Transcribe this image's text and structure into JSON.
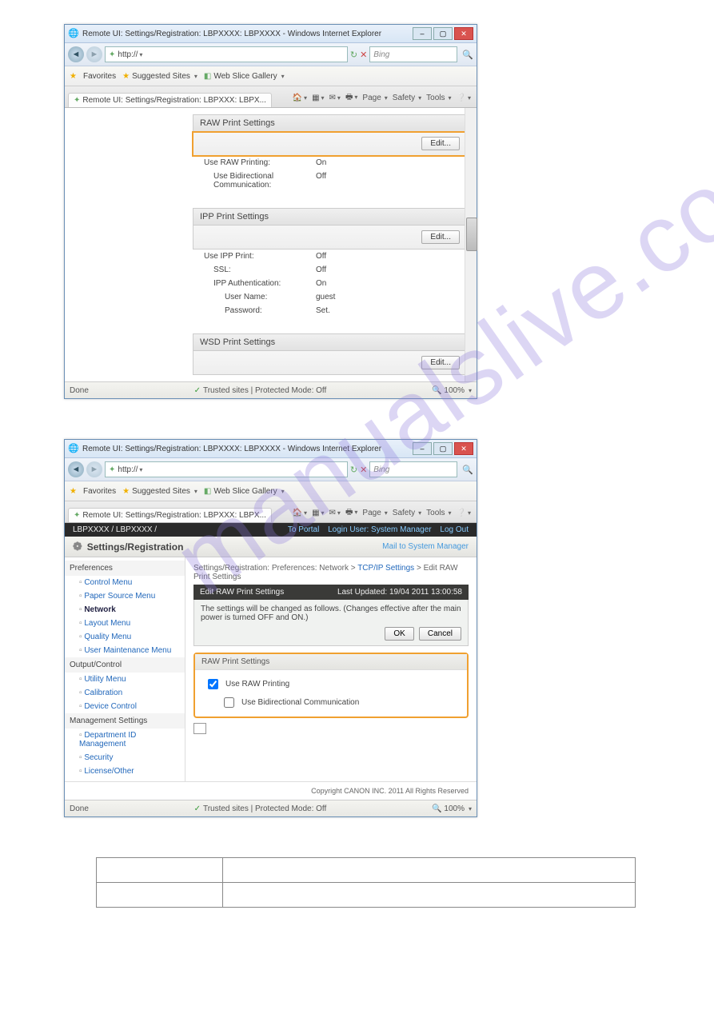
{
  "watermark": "manualslive.com",
  "window1": {
    "title": "Remote UI: Settings/Registration: LBPXXXX: LBPXXXX - Windows Internet Explorer",
    "url_prefix": "http://",
    "search_placeholder": "Bing",
    "favbar": {
      "favorites": "Favorites",
      "suggested": "Suggested Sites",
      "webslice": "Web Slice Gallery"
    },
    "tab_label": "Remote UI: Settings/Registration: LBPXXX: LBPX...",
    "toolbar": {
      "page": "Page",
      "safety": "Safety",
      "tools": "Tools"
    },
    "raw": {
      "section": "RAW Print Settings",
      "edit": "Edit...",
      "use_raw_label": "Use RAW Printing:",
      "use_raw_val": "On",
      "bidir_label": "Use Bidirectional Communication:",
      "bidir_val": "Off"
    },
    "ipp": {
      "section": "IPP Print Settings",
      "edit": "Edit...",
      "use_ipp_label": "Use IPP Print:",
      "use_ipp_val": "Off",
      "ssl_label": "SSL:",
      "ssl_val": "Off",
      "auth_label": "IPP Authentication:",
      "auth_val": "On",
      "user_label": "User Name:",
      "user_val": "guest",
      "pass_label": "Password:",
      "pass_val": "Set."
    },
    "wsd": {
      "section": "WSD Print Settings",
      "edit": "Edit..."
    },
    "status": {
      "done": "Done",
      "trusted": "Trusted sites | Protected Mode: Off",
      "zoom": "100%"
    }
  },
  "window2": {
    "title": "Remote UI: Settings/Registration: LBPXXXX: LBPXXXX - Windows Internet Explorer",
    "url_prefix": "http://",
    "search_placeholder": "Bing",
    "favbar": {
      "favorites": "Favorites",
      "suggested": "Suggested Sites",
      "webslice": "Web Slice Gallery"
    },
    "tab_label": "Remote UI: Settings/Registration: LBPXXX: LBPX...",
    "toolbar": {
      "page": "Page",
      "safety": "Safety",
      "tools": "Tools"
    },
    "blackbar": {
      "device": "LBPXXXX / LBPXXXX /",
      "portal": "To Portal",
      "login": "Login User: System Manager",
      "logout": "Log Out"
    },
    "reg": {
      "title": "Settings/Registration",
      "mailto": "Mail to System Manager"
    },
    "sidebar": {
      "cat1": "Preferences",
      "items1": [
        "Control Menu",
        "Paper Source Menu",
        "Network",
        "Layout Menu",
        "Quality Menu",
        "User Maintenance Menu"
      ],
      "cat2": "Output/Control",
      "items2": [
        "Utility Menu",
        "Calibration",
        "Device Control"
      ],
      "cat3": "Management Settings",
      "items3": [
        "Department ID Management",
        "Security",
        "License/Other"
      ]
    },
    "main": {
      "breadcrumb_prefix": "Settings/Registration: Preferences: Network > ",
      "breadcrumb_link": "TCP/IP Settings",
      "breadcrumb_tail": " > Edit RAW Print Settings",
      "panel_title": "Edit RAW Print Settings",
      "panel_updated": "Last Updated: 19/04 2011 13:00:58",
      "change_msg": "The settings will be changed as follows. (Changes effective after the main power is turned OFF and ON.)",
      "ok": "OK",
      "cancel": "Cancel",
      "fs_title": "RAW Print Settings",
      "cb1": "Use RAW Printing",
      "cb2": "Use Bidirectional Communication",
      "copyright": "Copyright CANON INC. 2011 All Rights Reserved"
    },
    "status": {
      "done": "Done",
      "trusted": "Trusted sites | Protected Mode: Off",
      "zoom": "100%"
    }
  }
}
